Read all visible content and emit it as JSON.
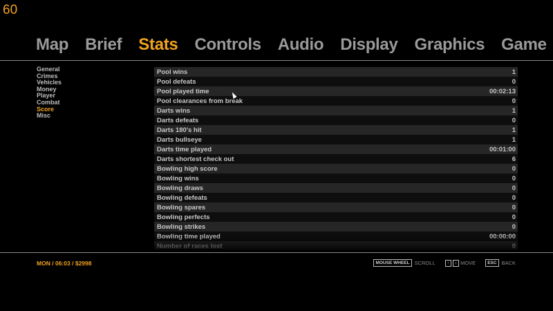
{
  "fps": "60",
  "tabs": [
    "Map",
    "Brief",
    "Stats",
    "Controls",
    "Audio",
    "Display",
    "Graphics",
    "Game"
  ],
  "active_tab": "Stats",
  "sidebar": [
    "General",
    "Crimes",
    "Vehicles",
    "Money",
    "Player",
    "Combat",
    "Score",
    "Misc"
  ],
  "active_sidebar": "Score",
  "stats": [
    {
      "label": "Pool wins",
      "value": "1"
    },
    {
      "label": "Pool defeats",
      "value": "0"
    },
    {
      "label": "Pool played time",
      "value": "00:02:13"
    },
    {
      "label": "Pool clearances from break",
      "value": "0"
    },
    {
      "label": "Darts wins",
      "value": "1"
    },
    {
      "label": "Darts defeats",
      "value": "0"
    },
    {
      "label": "Darts 180's hit",
      "value": "1"
    },
    {
      "label": "Darts bullseye",
      "value": "1"
    },
    {
      "label": "Darts time played",
      "value": "00:01:00"
    },
    {
      "label": "Darts shortest check out",
      "value": "6"
    },
    {
      "label": "Bowling high score",
      "value": "0"
    },
    {
      "label": "Bowling wins",
      "value": "0"
    },
    {
      "label": "Bowling draws",
      "value": "0"
    },
    {
      "label": "Bowling defeats",
      "value": "0"
    },
    {
      "label": "Bowling spares",
      "value": "0"
    },
    {
      "label": "Bowling perfects",
      "value": "0"
    },
    {
      "label": "Bowling strikes",
      "value": "0"
    },
    {
      "label": "Bowling time played",
      "value": "00:00:00"
    },
    {
      "label": "Number of races lost",
      "value": "0"
    }
  ],
  "footer": {
    "day": "MON",
    "sep1": "/",
    "time": "06:03",
    "sep2": "/",
    "money": "$2998"
  },
  "hints": {
    "mouse_key": "MOUSE WHEEL",
    "scroll_label": "SCROLL",
    "up_key": "↑",
    "down_key": "↓",
    "move_label": "MOVE",
    "esc_key": "ESC",
    "back_label": "BACK"
  },
  "colors": {
    "accent": "#f0a320",
    "text": "#bdbdbd",
    "row_odd": "#262626",
    "row_even": "#0e0e0e"
  }
}
